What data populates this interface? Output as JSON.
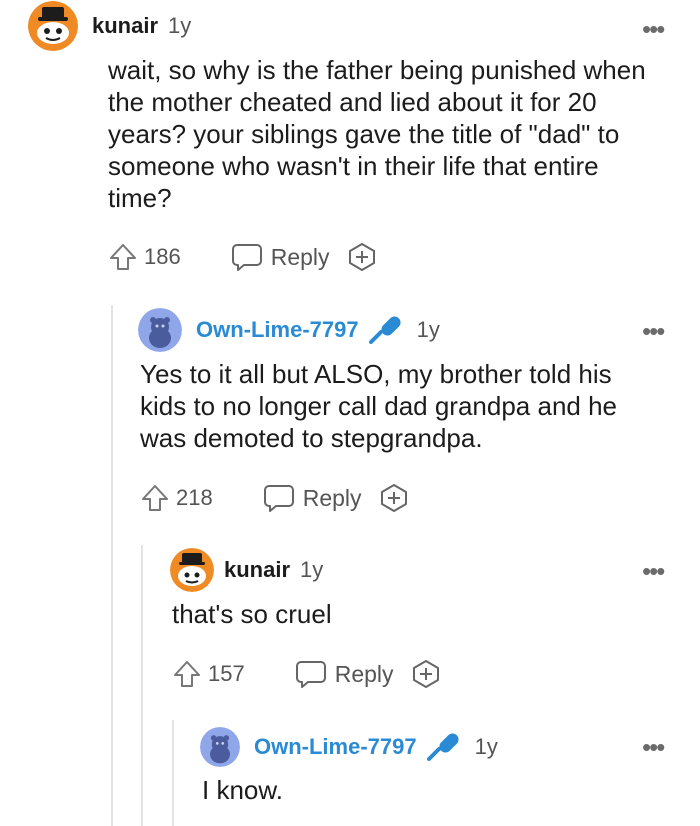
{
  "comments": [
    {
      "username": "kunair",
      "age": "1y",
      "text": "wait, so why is the father being punished when the mother cheated and lied about it for 20 years? your siblings gave the title of \"dad\" to someone who wasn't in their life that entire time?",
      "votes": "186",
      "reply_label": "Reply",
      "is_op": false
    },
    {
      "username": "Own-Lime-7797",
      "age": "1y",
      "text": "Yes to it all but ALSO, my brother told his kids to no longer call dad grandpa and he was demoted to stepgrandpa.",
      "votes": "218",
      "reply_label": "Reply",
      "is_op": true
    },
    {
      "username": "kunair",
      "age": "1y",
      "text": "that's so cruel",
      "votes": "157",
      "reply_label": "Reply",
      "is_op": false
    },
    {
      "username": "Own-Lime-7797",
      "age": "1y",
      "text": "I know.",
      "is_op": true
    }
  ],
  "more_glyph": "•••",
  "colors": {
    "op_username": "#2a8ad4",
    "mic": "#2a8ad4",
    "snoo_orange": "#f08a24",
    "snoo_blue": "#8fa7e8"
  },
  "icons": {
    "vote": "upvote-arrow-icon",
    "reply": "speech-bubble-icon",
    "award": "award-plus-icon",
    "mic": "microphone-icon",
    "more": "more-options-icon"
  }
}
